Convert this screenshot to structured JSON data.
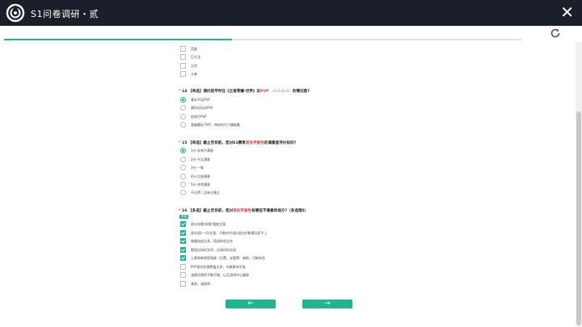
{
  "window": {
    "title": "S1问卷调研・贰",
    "close_icon": "✕"
  },
  "progress": {
    "fraction": 0.44
  },
  "q13_tail_options": [
    "西部",
    "巨大法",
    "左岸",
    "斗者"
  ],
  "q14": {
    "required_mark": "*",
    "number": "14",
    "tag": "【单选】",
    "pre": "请问您平时在《王者荣耀·世界》玩",
    "highlight": "PVP",
    "hint": "（1v1/4v4）",
    "post": "的情况是?",
    "options": [
      "基本不玩PVP",
      "偶尔玩玩些PVP",
      "经常打PVP",
      "我偏重玩 PVP，休闲的它只偶能重"
    ],
    "selected": 0
  },
  "q15": {
    "required_mark": "*",
    "number": "15",
    "tag": "【单选】",
    "pre": "截止至目前，您对S1赛季",
    "highlight": "竞技平衡性",
    "post": "的满意度评价如何?",
    "options": [
      "1分-非常不满意",
      "2分-不太满意",
      "3分-一般",
      "4分-比较满意",
      "5分-非常满意",
      "不记得 / 没有注意过"
    ],
    "selected": 0
  },
  "q16": {
    "required_mark": "*",
    "number": "16",
    "tag": "【多选】",
    "pre": "截止至目前，您对",
    "highlight": "竞技平衡性",
    "post": "有哪些不满意的地方?（多选限5）",
    "badge": "多选",
    "options": [
      "部分技能(技能)强度太强",
      "部分组(一式)太强，不能向它(组)适应对普通玩家不上",
      "装备加成太多，团战体验太杂",
      "野怪出场时太早，出场时间太快",
      "上赛季新阵容强度（位置、支援等）被削，可能有些",
      "PVP里的伤害数值太多，节奏影响不强",
      "该模式角色平衡不够，以至游戏中心偏离",
      "其他，请说明"
    ],
    "checked": [
      true,
      true,
      true,
      true,
      true,
      false,
      false,
      false
    ]
  },
  "nav": {
    "prev_label": "←",
    "next_label": "→"
  }
}
